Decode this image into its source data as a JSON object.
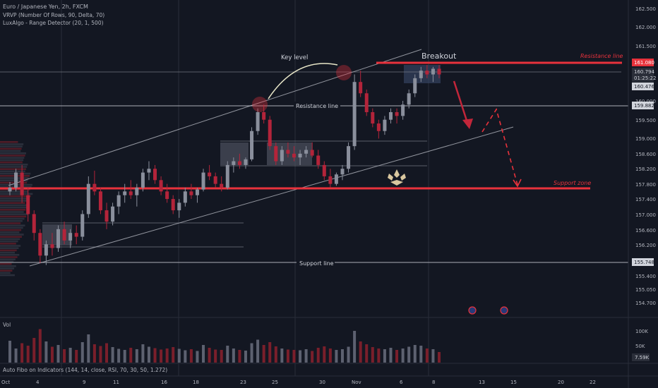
{
  "legend": {
    "symbol": "Euro / Japanese Yen, 2h, FXCM",
    "indicators": [
      "VRVP (Number Of Rows, 90, Delta, 70)",
      "LuxAlgo - Range Detector (20, 1, 500)"
    ]
  },
  "price_axis": {
    "ticks": [
      "162.500",
      "162.000",
      "161.500",
      "160.000",
      "159.500",
      "159.000",
      "158.600",
      "158.200",
      "157.800",
      "157.400",
      "157.000",
      "156.600",
      "156.200",
      "155.400",
      "155.050",
      "154.700"
    ],
    "labels": {
      "resistance": "161.080",
      "current": "160.794",
      "countdown": "01:25:22",
      "low_tag": "160.476",
      "line_159": "159.882",
      "support": "155.748"
    }
  },
  "volume_axis": {
    "ticks": [
      "100K",
      "50K"
    ],
    "current": "7.59K"
  },
  "time_axis": [
    "Oct",
    "4",
    "9",
    "11",
    "16",
    "18",
    "23",
    "25",
    "30",
    "Nov",
    "6",
    "8",
    "13",
    "15",
    "20",
    "22"
  ],
  "annotations": {
    "key_level": "Key level",
    "breakout": "Breakout",
    "resistance_line_red": "Resistance line",
    "resistance_line": "Resistance line",
    "support_zone": "Support zone",
    "support_line": "Support line"
  },
  "panes": {
    "volume": "Vol",
    "indicator": "Auto Fibo on Indicators (144, 14, close, RSI, 70, 30, 50, 1.272)"
  },
  "colors": {
    "background": "#131722",
    "bull": "#8a8f9c",
    "bear": "#b3243a",
    "red_line": "#e8323c",
    "grid": "#2a2e39",
    "text": "#b2b5be"
  },
  "candles": [
    [
      157.7,
      157.95,
      157.6,
      157.8
    ],
    [
      157.8,
      158.3,
      157.7,
      158.2
    ],
    [
      158.2,
      158.4,
      157.4,
      157.6
    ],
    [
      157.6,
      157.8,
      156.9,
      157.1
    ],
    [
      157.1,
      157.2,
      156.4,
      156.6
    ],
    [
      156.6,
      156.7,
      155.8,
      156.0
    ],
    [
      156.0,
      156.4,
      155.75,
      156.3
    ],
    [
      156.3,
      156.6,
      156.0,
      156.2
    ],
    [
      156.2,
      156.8,
      156.1,
      156.7
    ],
    [
      156.7,
      156.9,
      156.3,
      156.4
    ],
    [
      156.4,
      156.7,
      156.2,
      156.6
    ],
    [
      156.6,
      156.8,
      156.3,
      156.5
    ],
    [
      156.5,
      157.2,
      156.4,
      157.1
    ],
    [
      157.1,
      158.1,
      157.0,
      157.9
    ],
    [
      157.9,
      158.25,
      157.6,
      157.7
    ],
    [
      157.7,
      157.8,
      157.1,
      157.2
    ],
    [
      157.2,
      157.4,
      156.7,
      156.9
    ],
    [
      156.9,
      157.4,
      156.8,
      157.3
    ],
    [
      157.3,
      157.7,
      157.1,
      157.6
    ],
    [
      157.6,
      157.9,
      157.4,
      157.7
    ],
    [
      157.7,
      158.0,
      157.5,
      157.6
    ],
    [
      157.6,
      157.9,
      157.3,
      157.8
    ],
    [
      157.8,
      158.3,
      157.7,
      158.2
    ],
    [
      158.2,
      158.5,
      158.0,
      158.3
    ],
    [
      158.3,
      158.4,
      157.9,
      158.0
    ],
    [
      158.0,
      158.1,
      157.6,
      157.7
    ],
    [
      157.7,
      157.9,
      157.4,
      157.5
    ],
    [
      157.5,
      157.6,
      157.1,
      157.2
    ],
    [
      157.2,
      157.5,
      157.0,
      157.4
    ],
    [
      157.4,
      157.8,
      157.3,
      157.7
    ],
    [
      157.7,
      157.9,
      157.5,
      157.6
    ],
    [
      157.6,
      157.8,
      157.4,
      157.75
    ],
    [
      157.75,
      158.3,
      157.7,
      158.2
    ],
    [
      158.2,
      158.4,
      158.0,
      158.1
    ],
    [
      158.1,
      158.2,
      157.8,
      157.9
    ],
    [
      157.9,
      158.1,
      157.7,
      157.8
    ],
    [
      157.8,
      158.5,
      157.75,
      158.4
    ],
    [
      158.4,
      158.6,
      158.2,
      158.5
    ],
    [
      158.5,
      158.7,
      158.3,
      158.4
    ],
    [
      158.4,
      158.6,
      158.3,
      158.55
    ],
    [
      158.55,
      159.4,
      158.5,
      159.3
    ],
    [
      159.3,
      159.9,
      159.2,
      159.8
    ],
    [
      159.8,
      160.0,
      159.5,
      159.6
    ],
    [
      159.6,
      159.7,
      158.8,
      158.9
    ],
    [
      158.9,
      159.0,
      158.4,
      158.5
    ],
    [
      158.5,
      158.9,
      158.4,
      158.8
    ],
    [
      158.8,
      159.0,
      158.6,
      158.7
    ],
    [
      158.7,
      158.9,
      158.5,
      158.6
    ],
    [
      158.6,
      158.8,
      158.4,
      158.7
    ],
    [
      158.7,
      158.9,
      158.6,
      158.8
    ],
    [
      158.8,
      159.0,
      158.6,
      158.65
    ],
    [
      158.65,
      158.8,
      158.3,
      158.4
    ],
    [
      158.4,
      158.5,
      158.0,
      158.1
    ],
    [
      158.1,
      158.3,
      157.8,
      157.9
    ],
    [
      157.9,
      158.2,
      157.85,
      158.15
    ],
    [
      158.15,
      158.4,
      158.0,
      158.3
    ],
    [
      158.3,
      159.0,
      158.2,
      158.9
    ],
    [
      158.9,
      160.8,
      158.8,
      160.6
    ],
    [
      160.6,
      160.9,
      160.2,
      160.3
    ],
    [
      160.3,
      160.4,
      159.7,
      159.8
    ],
    [
      159.8,
      159.9,
      159.4,
      159.5
    ],
    [
      159.5,
      159.6,
      159.1,
      159.3
    ],
    [
      159.3,
      159.7,
      159.2,
      159.6
    ],
    [
      159.6,
      159.9,
      159.5,
      159.8
    ],
    [
      159.8,
      159.9,
      159.5,
      159.7
    ],
    [
      159.7,
      160.1,
      159.6,
      160.0
    ],
    [
      160.0,
      160.4,
      159.9,
      160.3
    ],
    [
      160.3,
      160.8,
      160.2,
      160.7
    ],
    [
      160.7,
      161.0,
      160.6,
      160.9
    ],
    [
      160.9,
      161.05,
      160.7,
      160.8
    ],
    [
      160.8,
      161.0,
      160.6,
      160.95
    ],
    [
      160.95,
      161.05,
      160.7,
      160.8
    ]
  ],
  "volumes": [
    62,
    40,
    55,
    48,
    70,
    95,
    60,
    45,
    50,
    38,
    42,
    36,
    58,
    80,
    52,
    47,
    55,
    44,
    39,
    36,
    42,
    38,
    52,
    45,
    41,
    37,
    40,
    44,
    39,
    35,
    38,
    33,
    50,
    42,
    37,
    36,
    48,
    40,
    36,
    34,
    55,
    65,
    50,
    58,
    46,
    40,
    37,
    36,
    35,
    38,
    33,
    42,
    46,
    40,
    36,
    38,
    45,
    90,
    60,
    52,
    44,
    40,
    38,
    42,
    36,
    40,
    45,
    50,
    48,
    40,
    38,
    30
  ]
}
